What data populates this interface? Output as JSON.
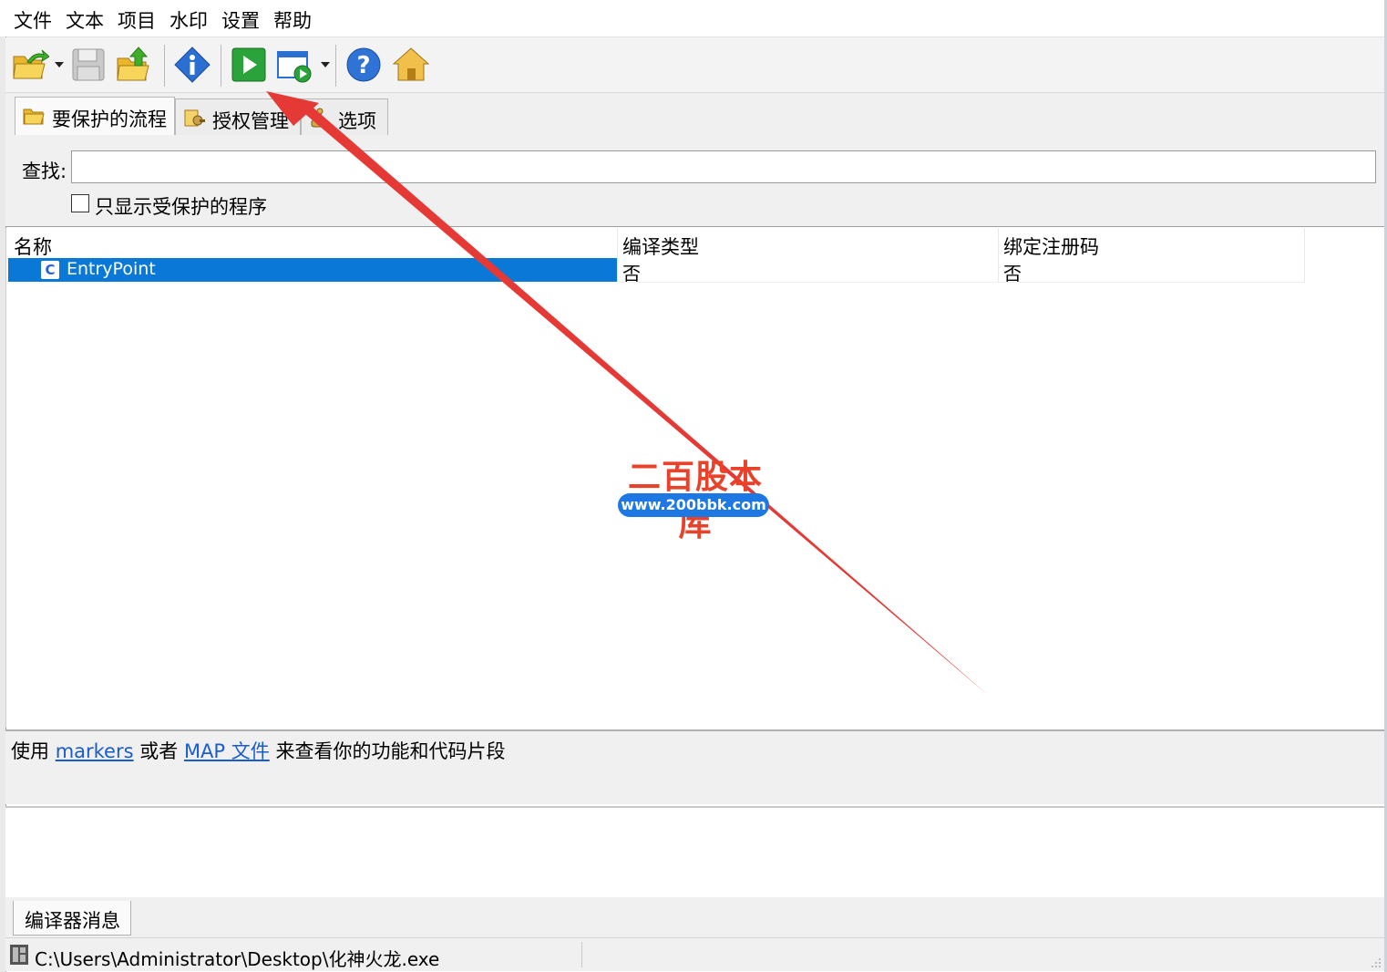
{
  "menu": [
    "文件",
    "文本",
    "项目",
    "水印",
    "设置",
    "帮助"
  ],
  "toolbar": {
    "icons": [
      "open-folder-icon",
      "save-disk-icon",
      "upload-folder-icon",
      "info-icon",
      "run-play-icon",
      "window-play-icon",
      "help-icon",
      "home-icon"
    ]
  },
  "tabs": [
    {
      "label": "要保护的流程",
      "icon": "folder-icon",
      "active": true
    },
    {
      "label": "授权管理",
      "icon": "license-icon",
      "active": false
    },
    {
      "label": "选项",
      "icon": "options-icon",
      "active": false
    }
  ],
  "search": {
    "label": "查找:",
    "value": ""
  },
  "filter": {
    "label": "只显示受保护的程序",
    "checked": false
  },
  "table": {
    "columns": [
      "名称",
      "编译类型",
      "绑定注册码"
    ],
    "rows": [
      {
        "icon_letter": "C",
        "name": "EntryPoint",
        "compile_type": "否",
        "bind_key": "否",
        "selected": true
      }
    ]
  },
  "info": {
    "prefix": "使用",
    "link1": "markers",
    "middle": "或者",
    "link2": "MAP 文件",
    "suffix": "来查看你的功能和代码片段"
  },
  "bottom_tab": "编译器消息",
  "status": {
    "path": "C:\\Users\\Administrator\\Desktop\\化神火龙.exe"
  },
  "watermark": {
    "title": "二百股本库",
    "url": "www.200bbk.com"
  },
  "colors": {
    "selection": "#0a78d7",
    "link": "#1a5ccf",
    "annotation_arrow": "#e53935",
    "watermark_red": "#e8432a",
    "watermark_blue": "#1e78e4"
  }
}
